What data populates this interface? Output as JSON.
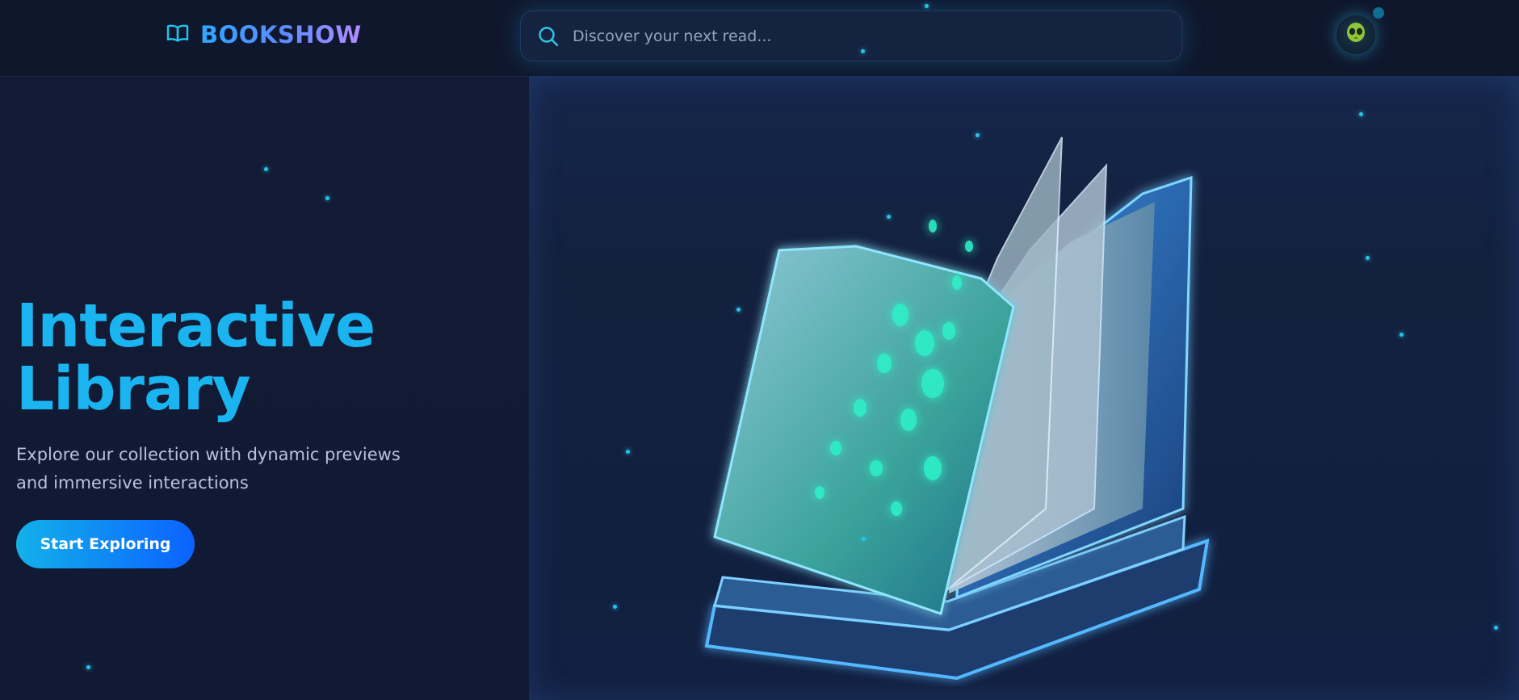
{
  "header": {
    "brand_name": "BOOKSHOW",
    "brand_icon": "open-book-icon",
    "search": {
      "placeholder": "Discover your next read...",
      "value": "",
      "icon": "search-icon"
    },
    "avatar_icon": "alien-avatar-icon"
  },
  "hero": {
    "title_line1": "Interactive",
    "title_line2": "Library",
    "subtitle": "Explore our collection with dynamic previews and immersive interactions",
    "cta_label": "Start Exploring",
    "illustration": "glowing-open-book-illustration"
  },
  "colors": {
    "background": "#111a33",
    "header": "#0f172d",
    "accent": "#1ab4f0",
    "cta_start": "#13b1ea",
    "cta_end": "#0b62ff",
    "brand_gradient_end": "#b38cff"
  }
}
